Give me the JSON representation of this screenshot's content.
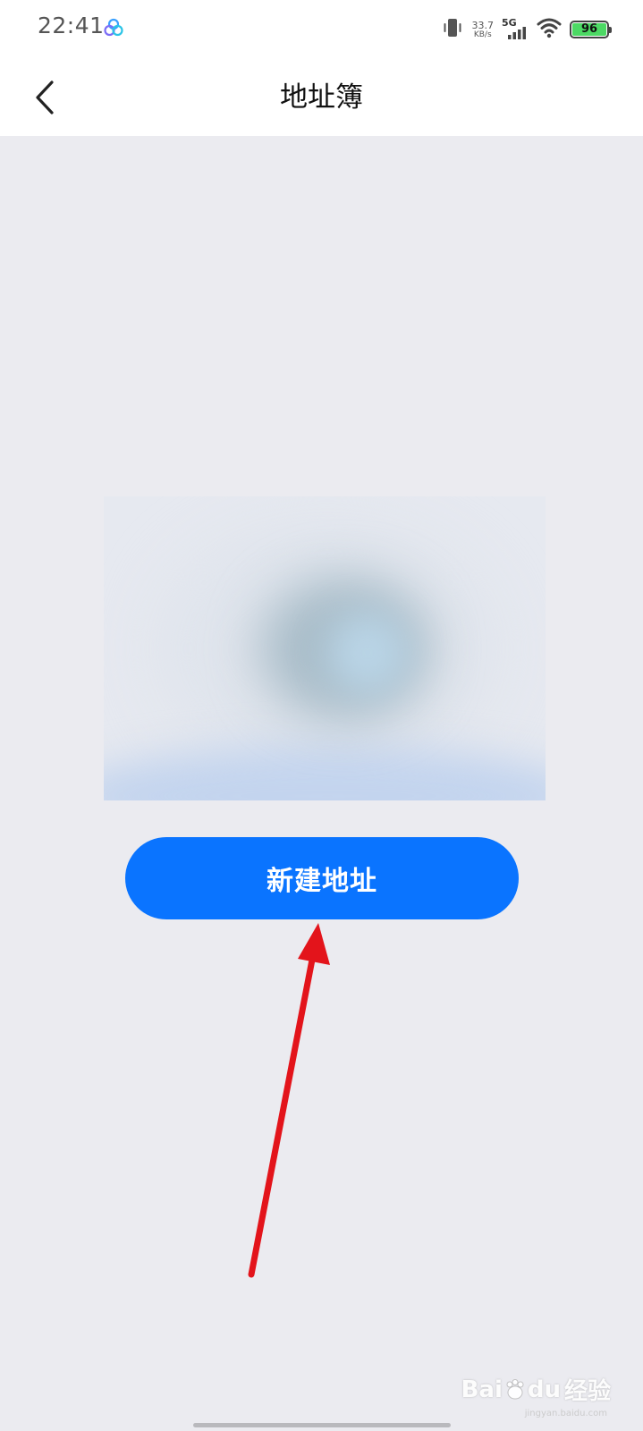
{
  "status_bar": {
    "time": "22:41",
    "net_speed_value": "33.7",
    "net_speed_unit": "KB/s",
    "network_type": "5G",
    "battery_level": "96",
    "icons": [
      "app-badge-icon",
      "vibrate-icon",
      "signal-icon",
      "wifi-icon",
      "battery-icon"
    ]
  },
  "nav": {
    "title": "地址簿",
    "back_icon": "chevron-left-icon"
  },
  "main": {
    "new_address_label": "新建地址"
  },
  "watermark": {
    "brand": "Bai",
    "brand_suffix": "du",
    "product": "经验",
    "url": "jingyan.baidu.com"
  },
  "colors": {
    "primary_button": "#0a74ff",
    "background": "#ebebf0",
    "annotation_arrow": "#e3141b",
    "battery_fill": "#4cd964"
  }
}
